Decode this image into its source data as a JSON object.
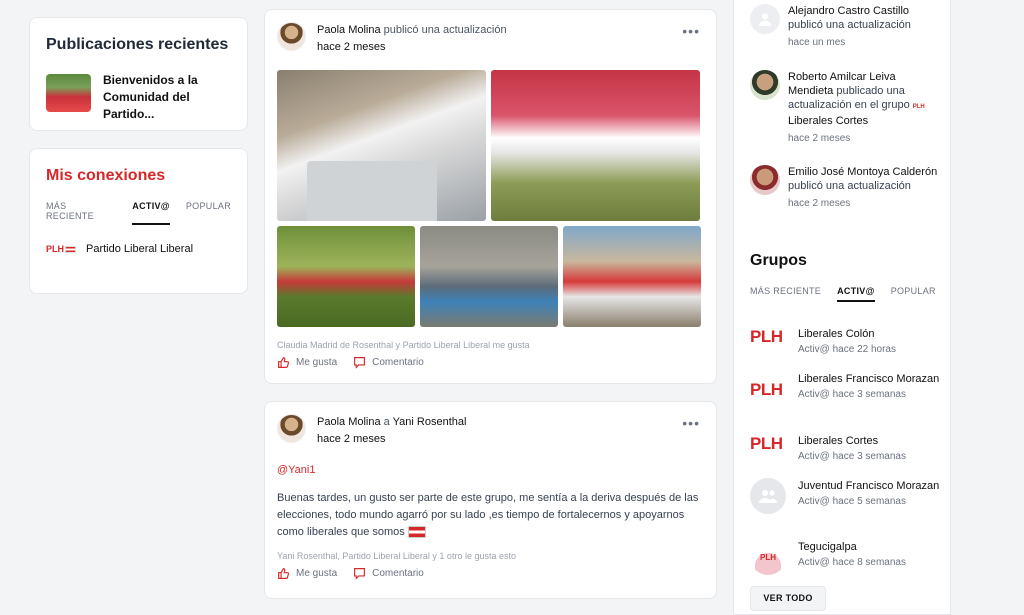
{
  "recent": {
    "title": "Publicaciones recientes",
    "item_title": "Bienvenidos a la Comunidad del Partido..."
  },
  "connections": {
    "title": "Mis conexiones",
    "tabs": [
      "MÁS RECIENTE",
      "ACTIV@",
      "POPULAR"
    ],
    "active_tab": "ACTIV@",
    "item_logo": "PLH",
    "item_name": "Partido Liberal Liberal"
  },
  "post1": {
    "author": "Paola Molina",
    "action": "publicó una actualización",
    "time": "hace 2 meses",
    "likes": "Claudia Madrid de Rosenthal y Partido Liberal Liberal me gusta",
    "like_label": "Me gusta",
    "comment_label": "Comentario"
  },
  "post2": {
    "author": "Paola Molina",
    "connector": "a",
    "target": "Yani Rosenthal",
    "time": "hace 2 meses",
    "mention": "@Yani1",
    "body": "Buenas tardes, un gusto ser parte de este grupo, me sentía a la deriva después de las elecciones, todo mundo agarró por su lado ,es tiempo de fortalecernos y apoyarnos como liberales que somos",
    "likes": "Yani Rosenthal, Partido Liberal Liberal y 1 otro le gusta esto",
    "like_label": "Me gusta",
    "comment_label": "Comentario"
  },
  "activity": [
    {
      "name": "Alejandro Castro Castillo",
      "text": "publicó una actualización",
      "time": "hace un mes"
    },
    {
      "name": "Roberto Amilcar Leiva Mendieta",
      "text": "publicado una actualización en el grupo",
      "group": "Liberales Cortes",
      "time": "hace 2 meses"
    },
    {
      "name": "Emilio José Montoya Calderón",
      "text": "publicó una actualización",
      "time": "hace 2 meses"
    }
  ],
  "groups": {
    "title": "Grupos",
    "tabs": [
      "MÁS RECIENTE",
      "ACTIV@",
      "POPULAR"
    ],
    "active_tab": "ACTIV@",
    "logo_text": "PLH",
    "items": [
      {
        "name": "Liberales Colón",
        "time": "Activ@ hace 22 horas"
      },
      {
        "name": "Liberales Francisco Morazan",
        "time": "Activ@ hace 3 semanas"
      },
      {
        "name": "Liberales Cortes",
        "time": "Activ@ hace 3 semanas"
      },
      {
        "name": "Juventud Francisco Morazan",
        "time": "Activ@ hace 5 semanas"
      },
      {
        "name": "Tegucigalpa",
        "time": "Activ@ hace 8 semanas"
      }
    ],
    "see_all": "VER TODO"
  },
  "colors": {
    "brand_red": "#d62828"
  }
}
